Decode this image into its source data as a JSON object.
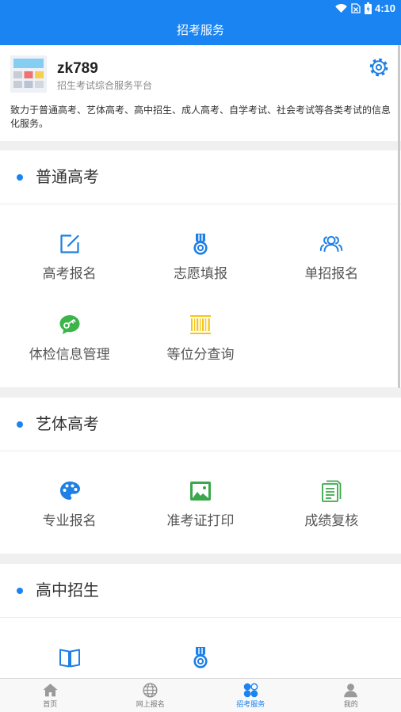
{
  "status_bar": {
    "time": "4:10"
  },
  "header": {
    "title": "招考服务"
  },
  "profile": {
    "name": "zk789",
    "subtitle": "招生考试综合服务平台",
    "description": "致力于普通高考、艺体高考、高中招生、成人高考、自学考试、社会考试等各类考试的信息化服务。",
    "avatar_icon": "app-grid-avatar",
    "settings_icon": "gear-icon"
  },
  "sections": [
    {
      "title": "普通高考",
      "items": [
        {
          "label": "高考报名",
          "icon": "edit-icon"
        },
        {
          "label": "志愿填报",
          "icon": "medal-icon"
        },
        {
          "label": "单招报名",
          "icon": "people-icon"
        },
        {
          "label": "体检信息管理",
          "icon": "chat-key-icon"
        },
        {
          "label": "等位分查询",
          "icon": "barcode-icon"
        }
      ]
    },
    {
      "title": "艺体高考",
      "items": [
        {
          "label": "专业报名",
          "icon": "palette-icon"
        },
        {
          "label": "准考证打印",
          "icon": "image-icon"
        },
        {
          "label": "成绩复核",
          "icon": "document-icon"
        }
      ]
    },
    {
      "title": "高中招生",
      "items": [
        {
          "icon": "book-icon"
        },
        {
          "icon": "medal-icon"
        }
      ]
    }
  ],
  "tabbar": {
    "active": 2,
    "items": [
      {
        "label": "首页",
        "icon": "home-icon"
      },
      {
        "label": "网上报名",
        "icon": "globe-icon"
      },
      {
        "label": "招考服务",
        "icon": "services-icon"
      },
      {
        "label": "我的",
        "icon": "person-icon"
      }
    ]
  },
  "colors": {
    "primary": "#1a84f3",
    "icon_blue": "#1e7fe6",
    "icon_green": "#3bb54a",
    "icon_yellow": "#f5c518",
    "tab_inactive": "#9a9a9a",
    "section_gap": "#f0f0f0"
  }
}
